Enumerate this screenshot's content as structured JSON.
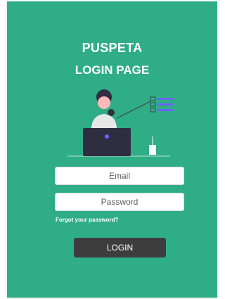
{
  "app": {
    "name": "PUSPETA",
    "subtitle": "LOGIN PAGE"
  },
  "form": {
    "email_placeholder": "Email",
    "password_placeholder": "Password",
    "forgot_link": "Forgot your password?",
    "login_label": "LOGIN"
  },
  "colors": {
    "card_bg": "#2fae86",
    "button_bg": "#3d3d3d",
    "laptop": "#2f2e41",
    "accent": "#6c63ff"
  },
  "illustration": {
    "icon": "person-at-laptop-illustration"
  }
}
